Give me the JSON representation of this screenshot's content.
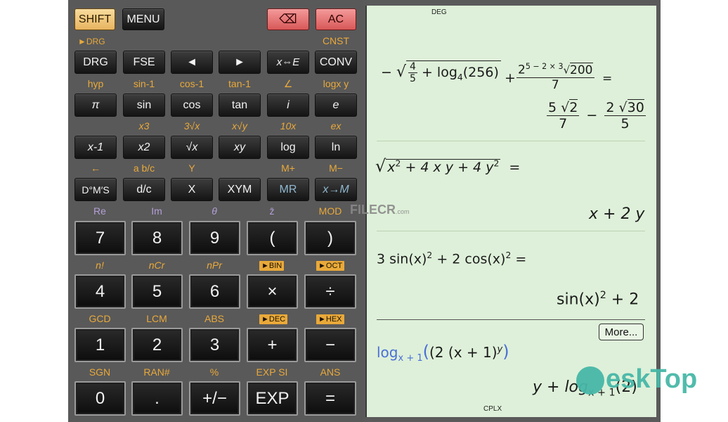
{
  "top": {
    "shift": "SHIFT",
    "menu": "MENU",
    "backspace": "⌫",
    "ac": "AC"
  },
  "labels_row1": {
    "drg_shift": "►DRG",
    "cnst": "CNST"
  },
  "row1": [
    "DRG",
    "FSE",
    "◄",
    "►",
    "x⇔E",
    "CONV"
  ],
  "labels_row2": [
    "hyp",
    "sin-1",
    "cos-1",
    "tan-1",
    "∠",
    "logx y"
  ],
  "row2": [
    "π",
    "sin",
    "cos",
    "tan",
    "i",
    "e"
  ],
  "labels_row3": [
    "x3",
    "3√x",
    "x√y",
    "10x",
    "ex"
  ],
  "row3": [
    "x-1",
    "x2",
    "√x",
    "xy",
    "log",
    "ln"
  ],
  "labels_row4": [
    "←",
    "a b/c",
    "Y",
    "M+",
    "M−"
  ],
  "row4": [
    "D°M′S",
    "d/c",
    "X",
    "XYM",
    "MR",
    "x→M"
  ],
  "labels_row5": [
    "Re",
    "Im",
    "θ",
    "z̄",
    "MOD"
  ],
  "row5": [
    "7",
    "8",
    "9",
    "(",
    ")"
  ],
  "labels_row6": [
    "n!",
    "nCr",
    "nPr",
    "►BIN",
    "►OCT"
  ],
  "row6": [
    "4",
    "5",
    "6",
    "×",
    "÷"
  ],
  "labels_row7": [
    "GCD",
    "LCM",
    "ABS",
    "►DEC",
    "►HEX"
  ],
  "row7": [
    "1",
    "2",
    "3",
    "+",
    "−"
  ],
  "labels_row8": [
    "SGN",
    "RAN#",
    "%",
    "EXP SI",
    "ANS"
  ],
  "row8": [
    "0",
    ".",
    "+/−",
    "EXP",
    "="
  ],
  "display": {
    "mode_top": "DEG",
    "mode_bottom": "CPLX",
    "more": "More...",
    "e1_minus": "−",
    "e1_frac_n": "4",
    "e1_frac_d": "5",
    "e1_log": "+ log",
    "e1_log_base": "4",
    "e1_log_arg": "(256)",
    "e1_plus": "+",
    "e1_top": "2",
    "e1_top_exp": "5 − 2 × 3",
    "e1_top_rad": "200",
    "e1_bottom": "7",
    "e1_eq": "=",
    "r1_n1": "5",
    "r1_r1": "2",
    "r1_d1": "7",
    "r1_minus": "−",
    "r1_n2": "2",
    "r1_r2": "30",
    "r1_d2": "5",
    "e2": "x2 + 4 x y + 4 y2",
    "e2_a": "x",
    "e2_b": " + 4 x y + 4 y",
    "e2_eq": "=",
    "r2": "x + 2 y",
    "e3_a": "3 sin(x)",
    "e3_b": " + 2 cos(x)",
    "e3_eq": " =",
    "r3_a": "sin(x)",
    "r3_b": " + 2",
    "e4_log": "log",
    "e4_base": "x + 1",
    "e4_arg": "(2 (x + 1)",
    "e4_exp": "y",
    "e4_close": ")",
    "r4_a": "y + log",
    "r4_base": "x + 1",
    "r4_arg": "(2)",
    "sq": "2"
  },
  "watermarks": {
    "filecr": "FILECR",
    "filecr_sub": ".com",
    "desktop": "eskTop"
  }
}
